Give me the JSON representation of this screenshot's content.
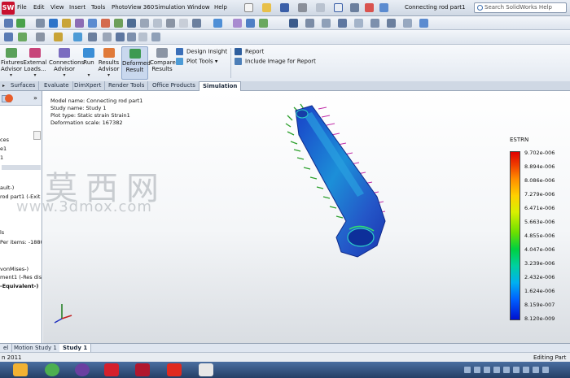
{
  "app": {
    "logo_text": "SW",
    "menu": [
      "File",
      "Edit",
      "View",
      "Insert",
      "Tools",
      "PhotoView 360",
      "Simulation",
      "Window",
      "Help"
    ],
    "document_title": "Connecting rod part1",
    "search_placeholder": "Search SolidWorks Help"
  },
  "command_manager": {
    "buttons": [
      {
        "label_line1": "Fixtures",
        "label_line2": "Advisor",
        "icon": "fixtures-icon"
      },
      {
        "label_line1": "External",
        "label_line2": "Loads...",
        "icon": "external-loads-icon"
      },
      {
        "label_line1": "Connections",
        "label_line2": "Advisor",
        "icon": "connections-icon"
      },
      {
        "label_line1": "Run",
        "label_line2": "",
        "icon": "run-icon"
      },
      {
        "label_line1": "Results",
        "label_line2": "Advisor",
        "icon": "results-icon"
      },
      {
        "label_line1": "Deformed",
        "label_line2": "Result",
        "icon": "deformed-result-icon"
      },
      {
        "label_line1": "Compare",
        "label_line2": "Results",
        "icon": "compare-results-icon"
      }
    ],
    "design_insight": "Design Insight",
    "plot_tools": "Plot Tools",
    "report": "Report",
    "include_image": "Include Image for Report"
  },
  "tabs": [
    "Surfaces",
    "Evaluate",
    "DimXpert",
    "Render Tools",
    "Office Products",
    "Simulation"
  ],
  "active_tab": "Simulation",
  "tree": {
    "lines": [
      "ces",
      "e1",
      "1",
      "ault-)",
      "rod part1 (-Exit",
      "ls",
      "Per items: -18800",
      "vonMises-)",
      "ment1 (-Res disp",
      "-Equivalent-)"
    ],
    "bold_line": "-Equivalent-)"
  },
  "plot_info": {
    "model_name": "Model name: Connecting rod part1",
    "study_name": "Study name: Study 1",
    "plot_type": "Plot type: Static strain Strain1",
    "deformation_scale": "Deformation scale: 167382"
  },
  "legend": {
    "title": "ESTRN",
    "values": [
      "9.702e-006",
      "8.894e-006",
      "8.086e-006",
      "7.279e-006",
      "6.471e-006",
      "5.663e-006",
      "4.855e-006",
      "4.047e-006",
      "3.239e-006",
      "2.432e-006",
      "1.624e-006",
      "8.159e-007",
      "8.120e-009"
    ],
    "colors": {
      "max": "#e00000",
      "mid": "#6ce000",
      "min": "#0010d0"
    }
  },
  "watermark": {
    "chinese": "莫西网",
    "url": "www.3dmox.com"
  },
  "bottom_tabs": [
    "el",
    "Motion Study 1",
    "Study 1"
  ],
  "active_bottom_tab": "Study 1",
  "status": {
    "left": "n 2011",
    "right": "Editing Part"
  },
  "taskbar_icons": [
    "show-desktop-icon",
    "chrome-icon",
    "media-player-icon",
    "solidworks-icon",
    "ruby-icon",
    "pdf-icon",
    "file-icon"
  ]
}
